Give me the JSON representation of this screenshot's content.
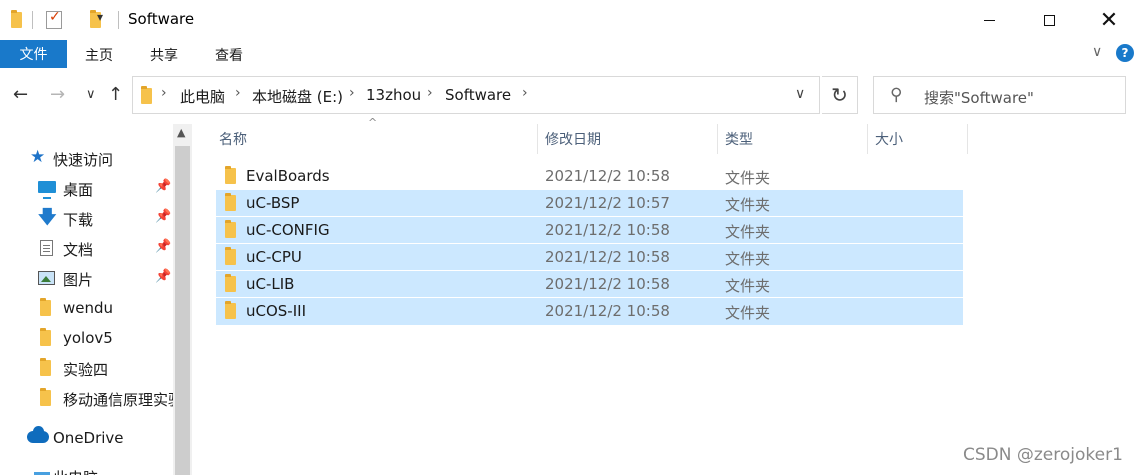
{
  "window": {
    "title": "Software",
    "dropdown_glyph": "▾",
    "minimize_icon": "minimize-icon",
    "maximize_icon": "maximize-icon",
    "close_glyph": "✕"
  },
  "ribbon": {
    "tabs": [
      {
        "label": "文件",
        "active": true,
        "accent": "#1979ca"
      },
      {
        "label": "主页"
      },
      {
        "label": "共享"
      },
      {
        "label": "查看"
      }
    ],
    "collapse_glyph": "∨",
    "help_glyph": "?"
  },
  "nav": {
    "back_glyph": "←",
    "forward_glyph": "→",
    "recent_glyph": "∨",
    "up_glyph": "↑",
    "breadcrumbs": [
      "此电脑",
      "本地磁盘 (E:)",
      "13zhou",
      "Software"
    ],
    "separator": "›",
    "dropdown_glyph": "∨",
    "refresh_glyph": "↻",
    "search_placeholder": "搜索\"Software\"",
    "search_glyph": "⚲"
  },
  "sidebar": {
    "quick_access": {
      "label": "快速访问",
      "icon": "star-icon"
    },
    "items": [
      {
        "label": "桌面",
        "icon": "desktop-icon",
        "pinned": true
      },
      {
        "label": "下载",
        "icon": "download-icon",
        "pinned": true
      },
      {
        "label": "文档",
        "icon": "document-icon",
        "pinned": true
      },
      {
        "label": "图片",
        "icon": "pictures-icon",
        "pinned": true
      },
      {
        "label": "wendu",
        "icon": "folder-icon",
        "pinned": false
      },
      {
        "label": "yolov5",
        "icon": "folder-icon",
        "pinned": false
      },
      {
        "label": "实验四",
        "icon": "folder-icon",
        "pinned": false
      },
      {
        "label": "移动通信原理实验",
        "icon": "folder-icon",
        "pinned": false
      }
    ],
    "onedrive": {
      "label": "OneDrive",
      "icon": "onedrive-icon"
    },
    "this_pc": {
      "label": "此电脑",
      "icon": "pc-icon"
    },
    "pin_glyph": "📌",
    "scroll_up_glyph": "▲"
  },
  "filelist": {
    "columns": [
      "名称",
      "修改日期",
      "类型",
      "大小"
    ],
    "sort_glyph": "^",
    "rows": [
      {
        "name": "EvalBoards",
        "date": "2021/12/2 10:58",
        "type": "文件夹",
        "size": "",
        "selected": false
      },
      {
        "name": "uC-BSP",
        "date": "2021/12/2 10:57",
        "type": "文件夹",
        "size": "",
        "selected": true
      },
      {
        "name": "uC-CONFIG",
        "date": "2021/12/2 10:58",
        "type": "文件夹",
        "size": "",
        "selected": true
      },
      {
        "name": "uC-CPU",
        "date": "2021/12/2 10:58",
        "type": "文件夹",
        "size": "",
        "selected": true
      },
      {
        "name": "uC-LIB",
        "date": "2021/12/2 10:58",
        "type": "文件夹",
        "size": "",
        "selected": true
      },
      {
        "name": "uCOS-III",
        "date": "2021/12/2 10:58",
        "type": "文件夹",
        "size": "",
        "selected": true
      }
    ],
    "selection_color": "#cce8ff"
  },
  "watermark": "CSDN @zerojoker1"
}
